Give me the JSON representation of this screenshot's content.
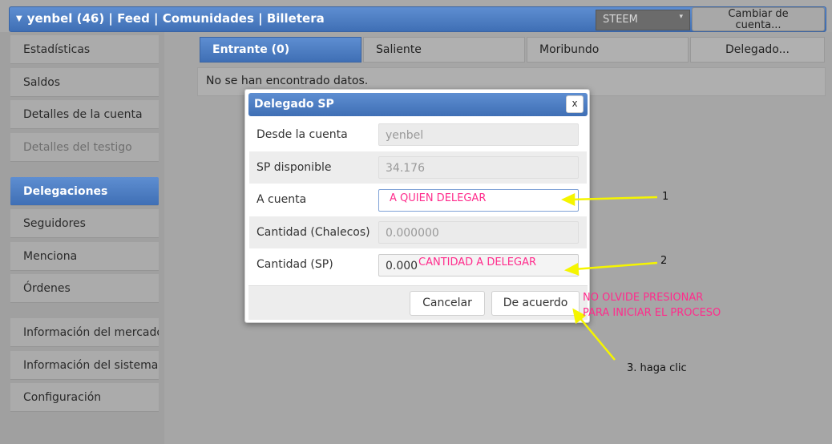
{
  "header": {
    "title": "yenbel (46) | Feed | Comunidades | Billetera",
    "network_select": "STEEM",
    "switch_account_line1": "Cambiar de",
    "switch_account_line2": "cuenta..."
  },
  "sidebar": {
    "items": [
      {
        "label": "Estadísticas"
      },
      {
        "label": "Saldos"
      },
      {
        "label": "Detalles de la cuenta"
      },
      {
        "label": "Detalles del testigo"
      },
      {
        "label": "Delegaciones"
      },
      {
        "label": "Seguidores"
      },
      {
        "label": "Menciona"
      },
      {
        "label": "Órdenes"
      },
      {
        "label": "Información del mercado"
      },
      {
        "label": "Información del sistema"
      },
      {
        "label": "Configuración"
      }
    ]
  },
  "tabs": [
    {
      "label": "Entrante (0)"
    },
    {
      "label": "Saliente"
    },
    {
      "label": "Moribundo"
    },
    {
      "label": "Delegado..."
    }
  ],
  "no_data": "No se han encontrado datos.",
  "dialog": {
    "title": "Delegado SP",
    "close": "x",
    "rows": [
      {
        "label": "Desde la cuenta",
        "value": "yenbel"
      },
      {
        "label": "SP disponible",
        "value": "34.176"
      },
      {
        "label": "A cuenta",
        "value": ""
      },
      {
        "label": "Cantidad (Chalecos)",
        "value": "0.000000"
      },
      {
        "label": "Cantidad (SP)",
        "value": "0.000"
      }
    ],
    "cancel": "Cancelar",
    "ok": "De acuerdo"
  },
  "annotations": {
    "to_whom": "A QUIEN DELEGAR",
    "amount": "CANTIDAD A DELEGAR",
    "step1": "1",
    "step2": "2",
    "remember_line1": "NO OLVIDE PRESIONAR",
    "remember_line2": "PARA INICIAR EL PROCESO",
    "step3": "3. haga clic"
  },
  "colors": {
    "accent": "#4a7cc4",
    "annotation_pink": "#ff2c8c",
    "annotation_arrow": "#f5f500"
  }
}
